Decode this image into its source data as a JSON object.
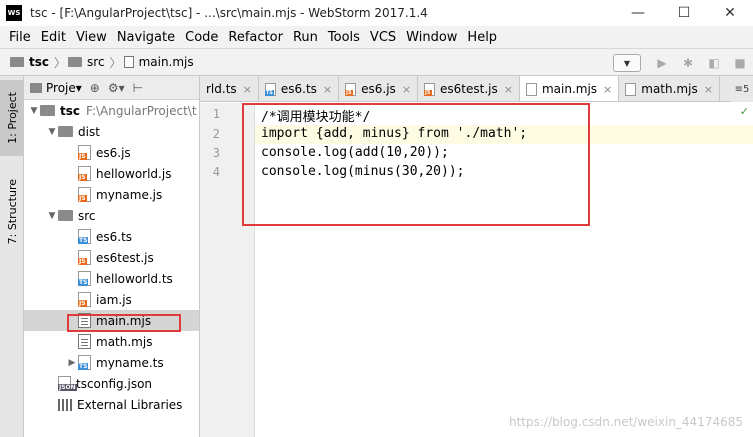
{
  "window": {
    "title": "tsc - [F:\\AngularProject\\tsc] - ...\\src\\main.mjs - WebStorm 2017.1.4",
    "logo": "WS",
    "minimize": "—",
    "maximize": "☐",
    "close": "✕"
  },
  "menu": [
    "File",
    "Edit",
    "View",
    "Navigate",
    "Code",
    "Refactor",
    "Run",
    "Tools",
    "VCS",
    "Window",
    "Help"
  ],
  "breadcrumb": {
    "project": "tsc",
    "folder": "src",
    "file": "main.mjs",
    "sep": "〉"
  },
  "toolbar": {
    "dropdown": "▼",
    "run": "▶",
    "debug": "✱",
    "coverage": "◧",
    "stop": "■"
  },
  "side_tabs": {
    "project": "1: Project",
    "structure": "7: Structure"
  },
  "panel": {
    "title": "Proje▾",
    "target_icon": "⊕",
    "settings": "⚙▾",
    "collapse": "⊢"
  },
  "tree": [
    {
      "label": "tsc",
      "path": "F:\\AngularProject\\t",
      "type": "folder",
      "arrow": "▼",
      "bold": true
    },
    {
      "label": "dist",
      "type": "folder",
      "arrow": "▼"
    },
    {
      "label": "es6.js",
      "type": "js"
    },
    {
      "label": "helloworld.js",
      "type": "js"
    },
    {
      "label": "myname.js",
      "type": "js"
    },
    {
      "label": "src",
      "type": "folder",
      "arrow": "▼"
    },
    {
      "label": "es6.ts",
      "type": "ts"
    },
    {
      "label": "es6test.js",
      "type": "js"
    },
    {
      "label": "helloworld.ts",
      "type": "ts"
    },
    {
      "label": "iam.js",
      "type": "js"
    },
    {
      "label": "main.mjs",
      "type": "mjs",
      "selected": true
    },
    {
      "label": "math.mjs",
      "type": "mjs"
    },
    {
      "label": "myname.ts",
      "type": "ts",
      "arrow": "▶"
    },
    {
      "label": "tsconfig.json",
      "type": "json"
    },
    {
      "label": "External Libraries",
      "type": "lib"
    }
  ],
  "icon_badges": {
    "js": "JS",
    "ts": "TS",
    "json": "JSON"
  },
  "tabs": [
    {
      "label": "rld.ts",
      "icon": "none"
    },
    {
      "label": "es6.ts",
      "icon": "ts"
    },
    {
      "label": "es6.js",
      "icon": "js"
    },
    {
      "label": "es6test.js",
      "icon": "js"
    },
    {
      "label": "main.mjs",
      "icon": "mjs",
      "active": true
    },
    {
      "label": "math.mjs",
      "icon": "mjs"
    }
  ],
  "tab_close": "×",
  "tab_more": "≡5",
  "code": {
    "lines": [
      "/*调用模块功能*/",
      "import {add, minus} from './math';",
      "console.log(add(10,20));",
      "console.log(minus(30,20));"
    ],
    "line_numbers": [
      "1",
      "2",
      "3",
      "4"
    ]
  },
  "status_check": "✓",
  "watermark": "https://blog.csdn.net/weixin_44174685",
  "colors": {
    "highlight": "#e03a3a",
    "js_badge": "#e86a1c",
    "ts_badge": "#3a8fd6",
    "caret_line": "#fdfbe2"
  }
}
